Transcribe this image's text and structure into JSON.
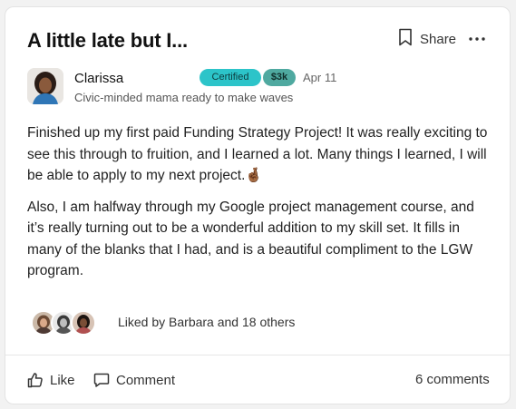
{
  "post": {
    "title": "A little late but I...",
    "share_label": "Share",
    "paragraphs": [
      "Finished up my first paid Funding Strategy Project! It was really exciting to see this through to fruition, and I learned a lot. Many things I learned, I will be able to apply to my next project.",
      "Also, I am halfway through my Google project management course, and it’s really turning out to be a wonderful addition to my skill set. It fills in many of the blanks that I had, and is a beautiful compliment to the LGW program."
    ],
    "emoji": "🤞🏾"
  },
  "author": {
    "name": "Clarissa",
    "tagline": "Civic-minded mama ready to make waves",
    "badge_certified": "Certified",
    "badge_amount": "$3k",
    "date": "Apr 11"
  },
  "engagement": {
    "liked_by": "Liked by Barbara and 18 others",
    "like_label": "Like",
    "comment_label": "Comment",
    "comments_count": "6 comments"
  },
  "colors": {
    "certified_badge": "#2cc4c9",
    "amount_badge": "#4fa9a0"
  },
  "icons": [
    "bookmark-icon",
    "share-icon",
    "more-icon",
    "thumbs-up-icon",
    "comment-icon"
  ]
}
